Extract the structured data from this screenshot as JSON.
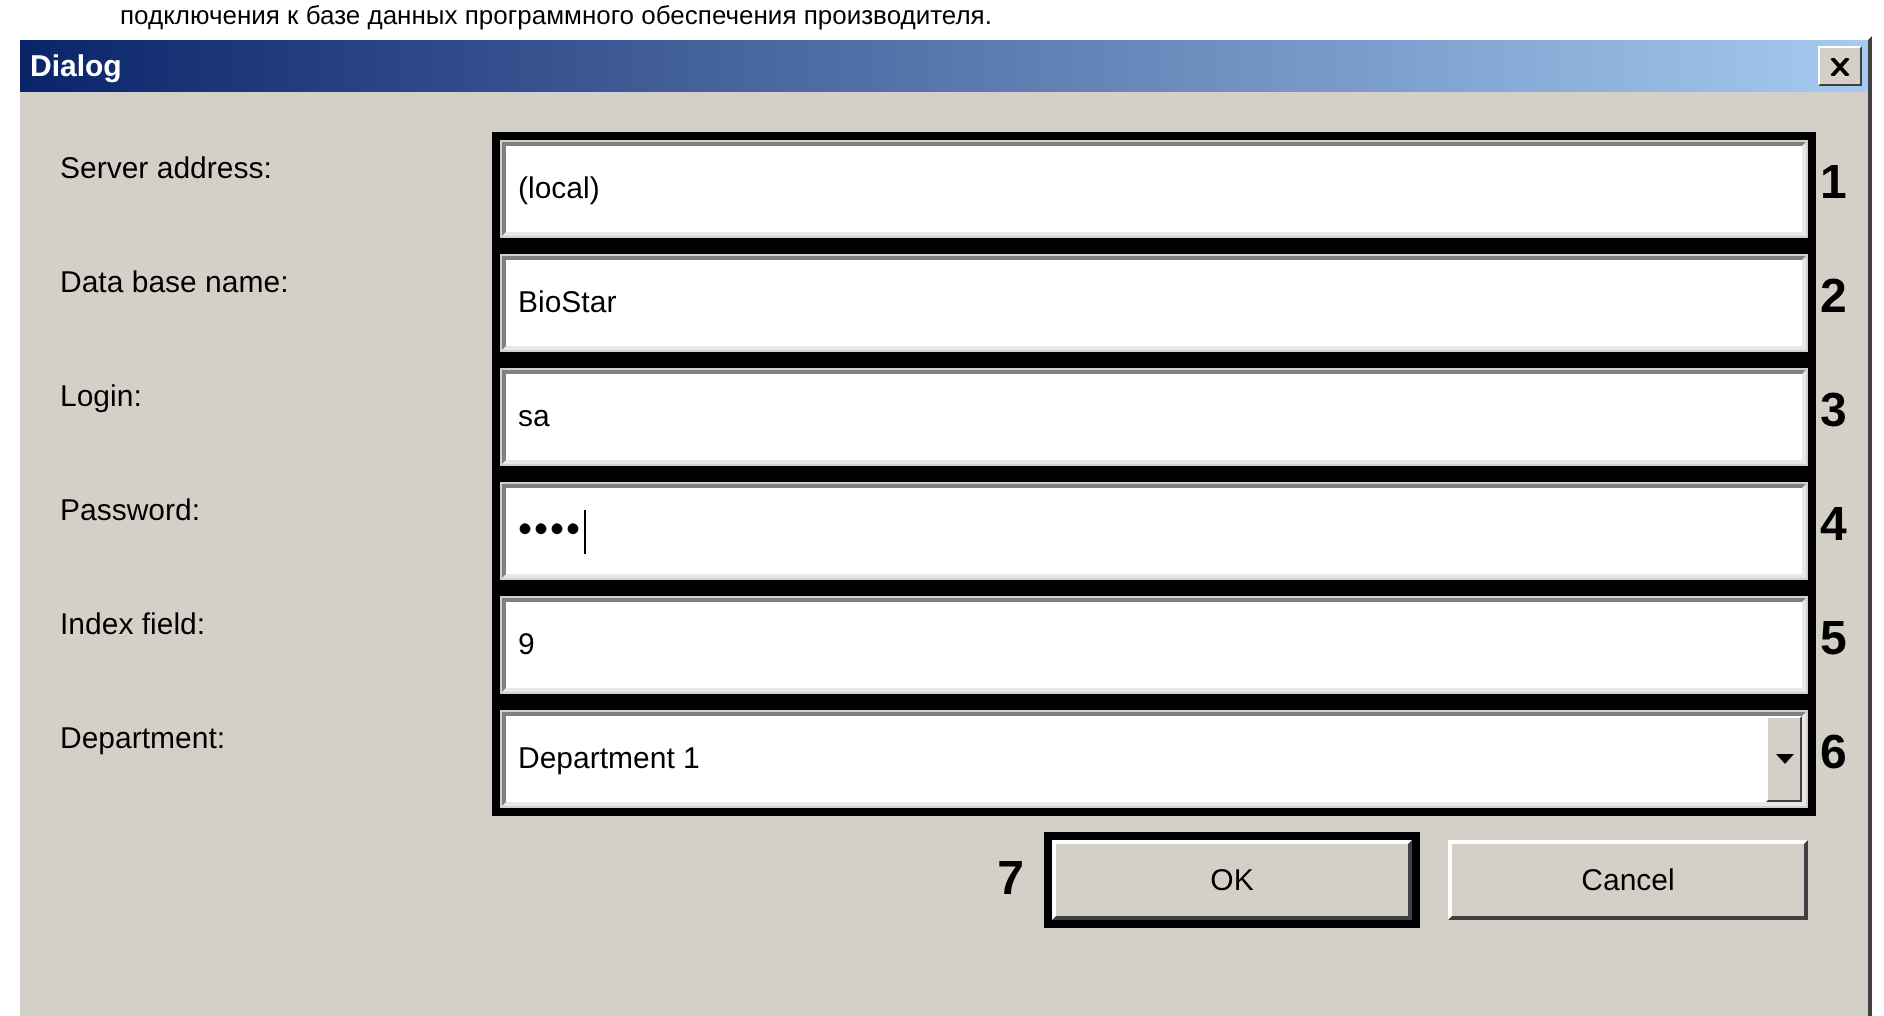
{
  "caption": "подключения к базе данных программного обеспечения производителя.",
  "window": {
    "title": "Dialog"
  },
  "fields": [
    {
      "kind": "text",
      "label": "Server address:",
      "value": "(local)",
      "marker": "1"
    },
    {
      "kind": "text",
      "label": "Data base name:",
      "value": "BioStar",
      "marker": "2"
    },
    {
      "kind": "text",
      "label": "Login:",
      "value": "sa",
      "marker": "3"
    },
    {
      "kind": "password",
      "label": "Password:",
      "value": "••••",
      "marker": "4"
    },
    {
      "kind": "text",
      "label": "Index field:",
      "value": "9",
      "marker": "5"
    },
    {
      "kind": "dropdown",
      "label": "Department:",
      "value": "Department 1",
      "marker": "6"
    }
  ],
  "buttons": [
    {
      "label": "OK",
      "marker": "7"
    },
    {
      "label": "Cancel"
    }
  ]
}
